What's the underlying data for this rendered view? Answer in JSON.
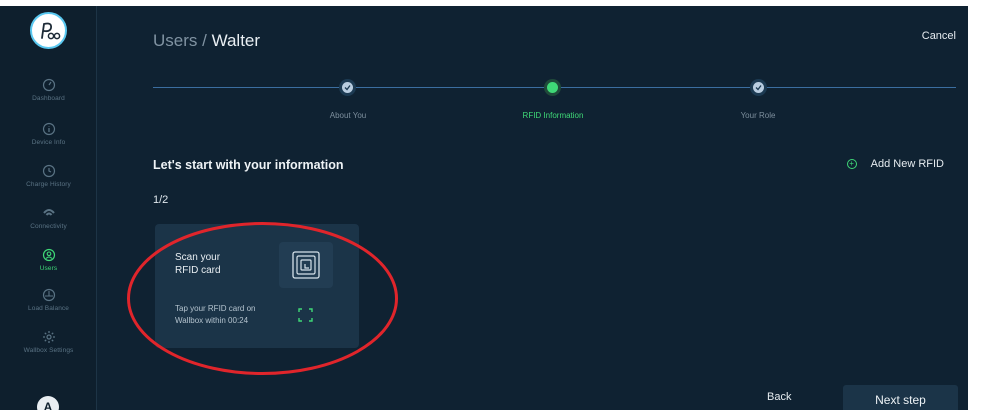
{
  "logo": {
    "text": "Poo"
  },
  "sidebar": {
    "items": [
      {
        "label": "Dashboard",
        "icon": "dashboard-icon"
      },
      {
        "label": "Device Info",
        "icon": "info-icon"
      },
      {
        "label": "Charge History",
        "icon": "history-icon"
      },
      {
        "label": "Connectivity",
        "icon": "wifi-icon"
      },
      {
        "label": "Users",
        "icon": "users-icon",
        "active": true
      },
      {
        "label": "Load Balance",
        "icon": "balance-icon"
      },
      {
        "label": "Wallbox Settings",
        "icon": "gear-icon"
      }
    ],
    "avatar_initial": "A"
  },
  "header": {
    "breadcrumb_parent": "Users / ",
    "breadcrumb_current": "Walter",
    "cancel_label": "Cancel"
  },
  "stepper": {
    "steps": [
      {
        "label": "About You",
        "state": "done"
      },
      {
        "label": "RFID Information",
        "state": "active"
      },
      {
        "label": "Your Role",
        "state": "pending"
      }
    ]
  },
  "content": {
    "title": "Let's start with your information",
    "add_rfid_label": "Add New RFID",
    "counter": "1/2"
  },
  "rfid_card": {
    "scan_line1": "Scan your",
    "scan_line2": "RFID card",
    "tap_line1": "Tap your RFID card on",
    "tap_line2": "Wallbox within 00:24"
  },
  "footer": {
    "back_label": "Back",
    "next_label": "Next step"
  },
  "colors": {
    "background": "#0f2232",
    "accent_green": "#3fd877",
    "annotation_red": "#e0252b"
  }
}
